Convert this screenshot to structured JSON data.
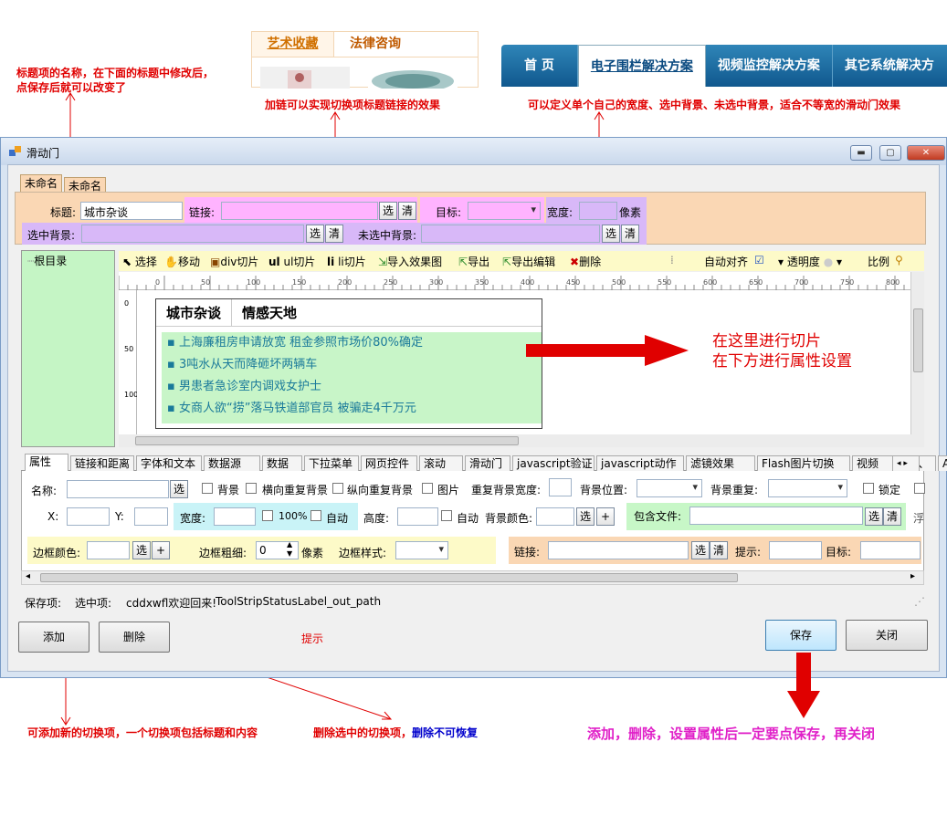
{
  "annotations": {
    "title_note": "标题项的名称，在下面的标题中修改后，点保存后就可以改变了",
    "link_note": "加链可以实现切换项标题链接的效果",
    "width_note": "可以定义单个自己的宽度、选中背景、未选中背景，适合不等宽的滑动门效果",
    "cut_note_1": "在这里进行切片",
    "cut_note_2": "在下方进行属性设置",
    "add_note": "可添加新的切换项，一个切换项包括标题和内容",
    "delete_note_a": "删除选中的切换项，",
    "delete_note_b": "删除不可恢复",
    "save_note": "添加，删除，设置属性后一定要点保存，再关闭"
  },
  "demo_tabs": [
    "艺术收藏",
    "法律咨询"
  ],
  "nav": [
    "首 页",
    "电子围栏解决方案",
    "视频监控解决方案",
    "其它系统解决方"
  ],
  "window": {
    "title": "滑动门",
    "btn_min": "▬",
    "btn_max": "▢",
    "btn_close": "✕"
  },
  "item_tabs": [
    "未命名",
    "未命名"
  ],
  "form": {
    "title_label": "标题:",
    "title_value": "城市杂谈",
    "link_label": "链接:",
    "select_btn": "选",
    "clear_btn": "清",
    "target_label": "目标:",
    "width_label": "宽度:",
    "width_unit": "像素",
    "sel_bg_label": "选中背景:",
    "unsel_bg_label": "未选中背景:"
  },
  "tree": {
    "root": "根目录"
  },
  "toolbar": {
    "select": "选择",
    "move": "移动",
    "div_cut": "div切片",
    "ul_cut": "ul切片",
    "li_cut": "li切片",
    "import": "导入效果图",
    "export": "导出",
    "export_edit": "导出编辑",
    "delete": "删除",
    "auto_align": "自动对齐",
    "opacity": "透明度",
    "ratio": "比例"
  },
  "ruler_ticks": [
    "0",
    "50",
    "100",
    "150",
    "200",
    "250",
    "300",
    "350",
    "400",
    "450",
    "500",
    "550",
    "600",
    "650",
    "700",
    "750",
    "800"
  ],
  "vruler_ticks": [
    "0",
    "50",
    "100"
  ],
  "preview": {
    "tabs": [
      "城市杂谈",
      "情感天地"
    ],
    "items": [
      "上海廉租房申请放宽 租金参照市场价80%确定",
      "3吨水从天而降砸坏两辆车",
      "男患者急诊室内调戏女护士",
      "女商人欲“捞”落马铁道部官员 被骗走4千万元"
    ]
  },
  "prop_tabs": [
    "属性",
    "链接和距离",
    "字体和文本",
    "数据源",
    "数据",
    "下拉菜单",
    "网页控件",
    "滚动",
    "滑动门",
    "javascript验证",
    "javascript动作",
    "滤镜效果",
    "Flash图片切换",
    "视频",
    "插入",
    "A"
  ],
  "props": {
    "name": "名称:",
    "select": "选",
    "bg": "背景",
    "h_repeat": "横向重复背景",
    "v_repeat": "纵向重复背景",
    "image": "图片",
    "repeat_width": "重复背景宽度:",
    "bg_pos": "背景位置:",
    "bg_repeat": "背景重复:",
    "lock": "锁定",
    "x": "X:",
    "y": "Y:",
    "width": "宽度:",
    "pct100": "100%",
    "auto": "自动",
    "height": "高度:",
    "auto2": "自动",
    "bg_color": "背景颜色:",
    "plus": "+",
    "include_file": "包含文件:",
    "clear": "清",
    "float": "浮",
    "border_color": "边框颜色:",
    "border_width": "边框粗细:",
    "border_width_value": "0",
    "px": "像素",
    "border_style": "边框样式:",
    "link": "链接:",
    "tip": "提示:",
    "target": "目标:"
  },
  "status": {
    "save": "保存项:",
    "selected": "选中项:",
    "welcome": "cddxwfl欢迎回来!",
    "label": "ToolStripStatusLabel_out_path"
  },
  "buttons": {
    "add": "添加",
    "delete": "删除",
    "hint": "提示",
    "save": "保存",
    "close": "关闭"
  },
  "colors": {
    "annotation_red": "#e00000",
    "form_bg": "#fad7b4",
    "link_bg": "#ffb3ff",
    "selbg": "#d8b8f8",
    "tree_bg": "#c5f5c5",
    "toolbar_bg": "#fdfac8"
  }
}
